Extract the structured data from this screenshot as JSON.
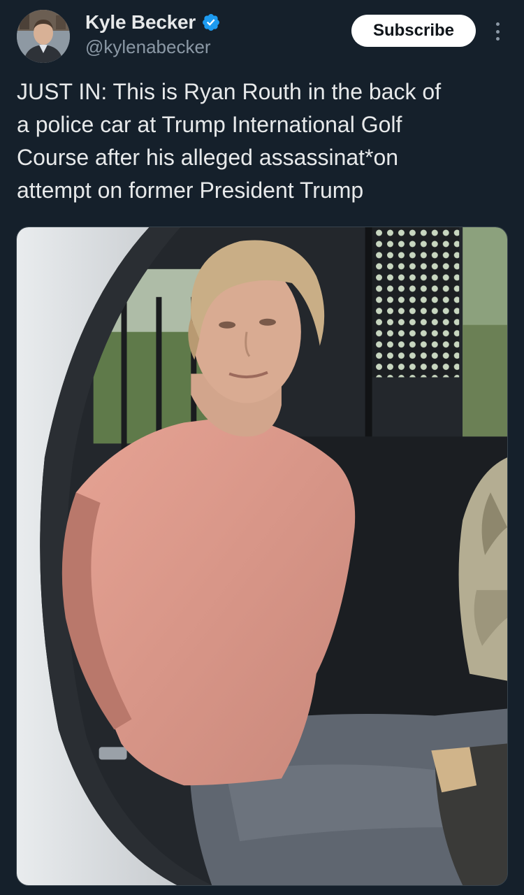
{
  "author": {
    "display_name": "Kyle Becker",
    "handle": "@kylenabecker",
    "verified": true,
    "avatar_icon": "profile-photo"
  },
  "actions": {
    "subscribe_label": "Subscribe",
    "more_icon": "more-vertical-icon"
  },
  "tweet": {
    "text": "JUST IN: This is Ryan Routh in the back of\na police car at Trump International Golf\nCourse after his alleged assassinat*on\nattempt on former President Trump"
  },
  "media": {
    "type": "photo"
  },
  "colors": {
    "background": "#15202b",
    "text_primary": "#e7e9ea",
    "text_secondary": "#8b98a5",
    "verified_blue": "#1d9bf0",
    "button_bg": "#ffffff",
    "button_text": "#0f1419"
  }
}
